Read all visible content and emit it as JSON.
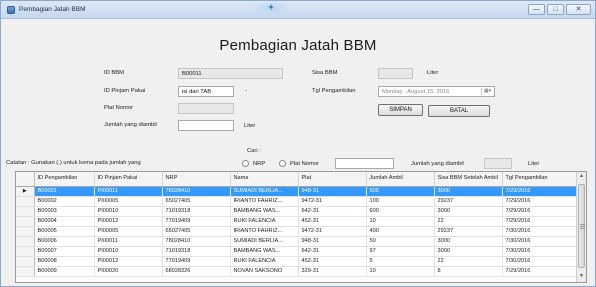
{
  "window": {
    "title": "Pembagian Jatah BBM",
    "min_glyph": "—",
    "max_glyph": "□",
    "close_glyph": "✕"
  },
  "heading": "Pembagian Jatah BBM",
  "form": {
    "id_bbm_label": "ID BBM",
    "id_bbm_value": "B00011",
    "id_pinjam_label": "ID Pinjam Pakai",
    "id_pinjam_value": "isi dan TAB",
    "id_pinjam_suffix": "-",
    "plat_label": "Plat Nomor",
    "plat_value": "",
    "jumlah_label": "Jumlah yang diambil",
    "jumlah_value": "",
    "jumlah_unit": "Liter",
    "sisa_label": "Sisa BBM",
    "sisa_value": "",
    "sisa_unit": "Liter",
    "tgl_label": "Tgl Pengambilan",
    "tgl_value": "Monday  ,  August   15, 2016",
    "simpan_label": "SIMPAN",
    "batal_label": "BATAL"
  },
  "search": {
    "cari_label": "Cari :",
    "nrp_label": "NRP",
    "plat_label": "Plat Nomor",
    "query": "",
    "jumlah_label": "Jumlah yang diambil",
    "jumlah_value": "",
    "jumlah_unit": "Liter"
  },
  "note": "Catatan : Gunakan (.) untuk koma pada jumlah yang",
  "table": {
    "row_indicator": "▶",
    "columns": [
      "ID Pengambilan",
      "ID Pinjam Pakai",
      "NRP",
      "Nama",
      "Plat",
      "Jumlah Ambil",
      "Sisa BBM Setelah Ambil",
      "Tgl Pengambilan"
    ],
    "rows": [
      [
        "B00001",
        "PI00011",
        "78028410",
        "SUMIADI BERLIA...",
        "948-31",
        "500",
        "3000",
        "7/29/2016"
      ],
      [
        "B00002",
        "PI00005",
        "65027405",
        "IRIANTO FAHRIZ...",
        "9472-31",
        "100",
        "29237",
        "7/29/2016"
      ],
      [
        "B00003",
        "PI00010",
        "71019318",
        "BAMBANG WAS...",
        "642-31",
        "600",
        "3000",
        "7/29/2016"
      ],
      [
        "B00004",
        "PI00012",
        "77019409",
        "RUKI FALENCIA",
        "452-31",
        "10",
        "22",
        "7/29/2016"
      ],
      [
        "B00005",
        "PI00005",
        "65027405",
        "IRIANTO FAHRIZ...",
        "9472-31",
        "400",
        "29237",
        "7/30/2016"
      ],
      [
        "B00006",
        "PI00011",
        "78028410",
        "SUMIADI BERLIA...",
        "948-31",
        "50",
        "3000",
        "7/30/2016"
      ],
      [
        "B00007",
        "PI00010",
        "71019318",
        "BAMBANG WAS...",
        "642-31",
        "97",
        "3000",
        "7/30/2016"
      ],
      [
        "B00008",
        "PI00012",
        "77019409",
        "RUKI FALENCIA",
        "452-31",
        "5",
        "22",
        "7/30/2016"
      ],
      [
        "B00009",
        "PI00020",
        "68028326",
        "NOVAN SAKSONO",
        "329-31",
        "10",
        "8",
        "7/29/2016"
      ]
    ],
    "selected_row": 0
  },
  "colors": {
    "selection": "#3399ff",
    "window_bg": "#f0f0f0",
    "titlebar": "#c5d8ef"
  }
}
